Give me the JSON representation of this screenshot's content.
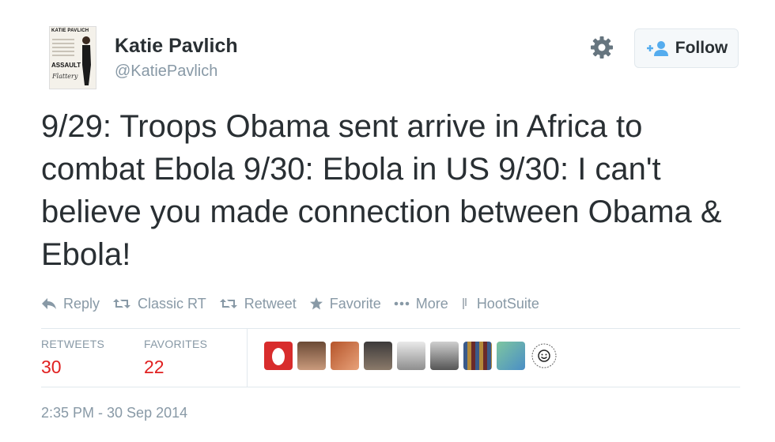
{
  "user": {
    "name": "Katie Pavlich",
    "handle": "@KatiePavlich",
    "avatar_icon": "book-cover-avatar",
    "avatar_text": [
      "KATIE PAVLICH",
      "ASSAULT",
      "Flattery"
    ]
  },
  "header": {
    "settings_icon": "gear-icon",
    "follow_label": "Follow",
    "follow_icon": "add-user-icon"
  },
  "tweet": {
    "text": "9/29: Troops Obama sent arrive in Africa to combat Ebola 9/30: Ebola in US 9/30: I can't believe you made connection between Obama & Ebola!",
    "timestamp": "2:35 PM - 30 Sep 2014"
  },
  "actions": [
    {
      "label": "Reply",
      "icon": "reply-icon"
    },
    {
      "label": "Classic RT",
      "icon": "retweet-icon"
    },
    {
      "label": "Retweet",
      "icon": "retweet-icon"
    },
    {
      "label": "Favorite",
      "icon": "star-icon"
    },
    {
      "label": "More",
      "icon": "more-dots-icon"
    },
    {
      "label": "HootSuite",
      "icon": "hootsuite-icon"
    }
  ],
  "stats": {
    "retweets_label": "RETWEETS",
    "retweets_count": "30",
    "favorites_label": "FAVORITES",
    "favorites_count": "22"
  },
  "colors": {
    "text": "#292f33",
    "muted": "#8899a6",
    "count": "#e02020",
    "divider": "#e1e8ed"
  }
}
